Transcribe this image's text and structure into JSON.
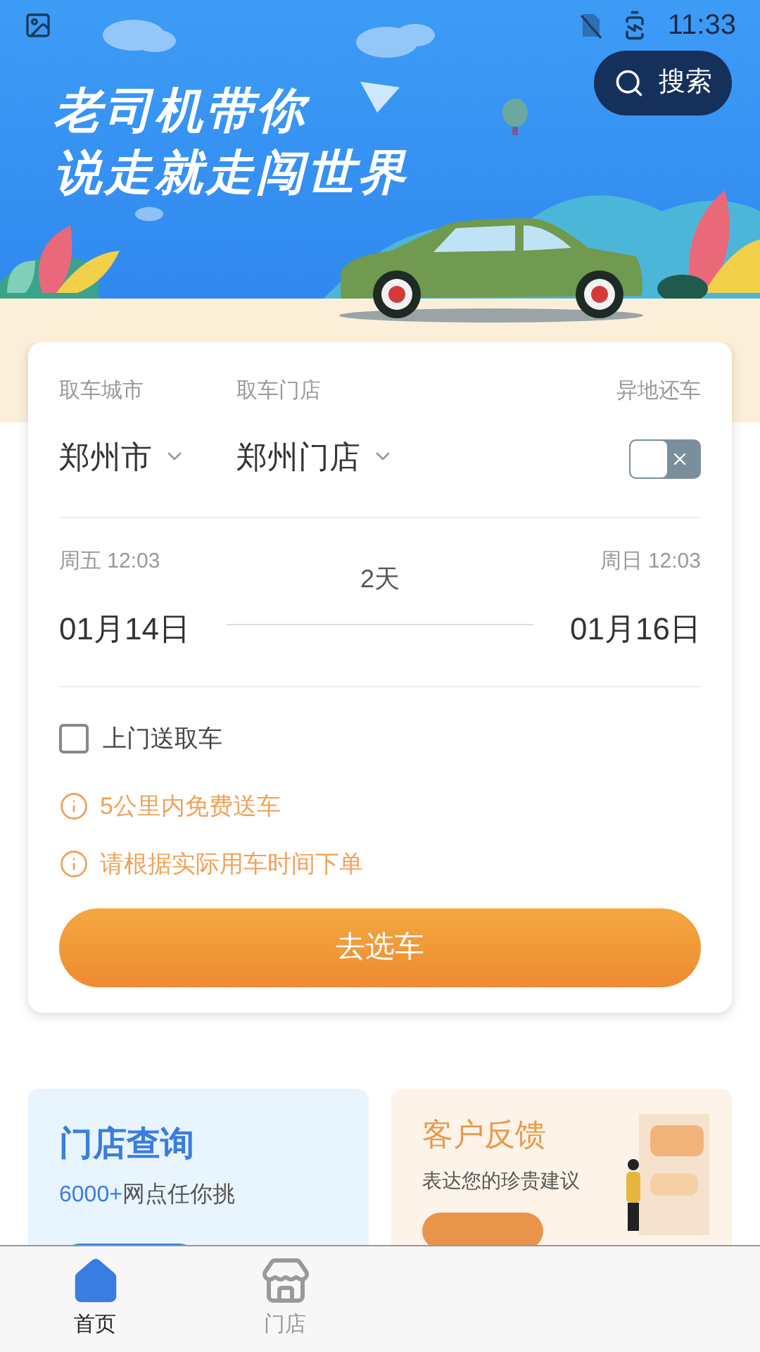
{
  "status_bar": {
    "time": "11:33"
  },
  "banner": {
    "headline": [
      "老司机带你",
      "说走就走闯世界"
    ],
    "search_button": "搜索"
  },
  "booking": {
    "pickup_city": {
      "label": "取车城市",
      "value": "郑州市"
    },
    "pickup_store": {
      "label": "取车门店",
      "value": "郑州门店"
    },
    "remote_return": {
      "label": "异地还车",
      "on": false
    },
    "pickup": {
      "weekday_time": "周五 12:03",
      "date": "01月14日"
    },
    "duration": "2天",
    "return": {
      "weekday_time": "周日 12:03",
      "date": "01月16日"
    },
    "door_delivery": {
      "label": "上门送取车",
      "checked": false
    },
    "tips": [
      "5公里内免费送车",
      "请根据实际用车时间下单"
    ],
    "submit": "去选车"
  },
  "promo_cards": [
    {
      "kind": "store",
      "title": "门店查询",
      "subtitle_highlight": "6000+",
      "subtitle": "网点任你挑"
    },
    {
      "kind": "feedback",
      "title": "客户反馈",
      "subtitle": "表达您的珍贵建议"
    }
  ],
  "tab_bar": [
    {
      "kind": "home",
      "label": "首页",
      "selected": true
    },
    {
      "kind": "store",
      "label": "门店",
      "selected": false
    }
  ]
}
